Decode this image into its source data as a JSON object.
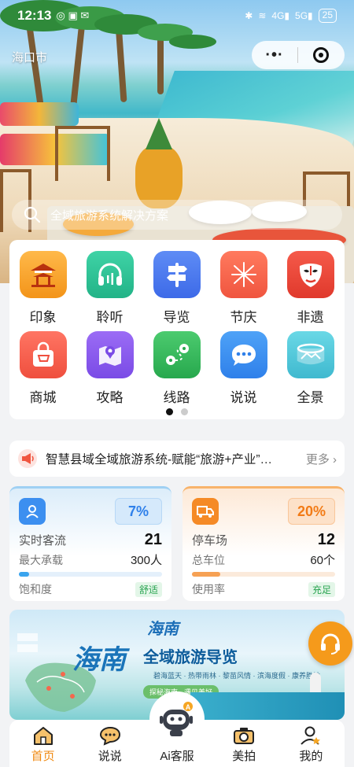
{
  "status": {
    "time": "12:13",
    "battery": "25"
  },
  "header": {
    "city": "海口市",
    "more_icon": "ellipsis-icon",
    "target_icon": "target-icon"
  },
  "search": {
    "placeholder": "全域旅游系统解决方案"
  },
  "menu": {
    "items": [
      {
        "label": "印象",
        "icon": "pavilion-icon",
        "color": "#f6a623"
      },
      {
        "label": "聆听",
        "icon": "headphones-icon",
        "color": "#2fc39a"
      },
      {
        "label": "导览",
        "icon": "signpost-icon",
        "color": "#4a7cf0"
      },
      {
        "label": "节庆",
        "icon": "fireworks-icon",
        "color": "#f5684d"
      },
      {
        "label": "非遗",
        "icon": "opera-mask-icon",
        "color": "#ef4b3c"
      },
      {
        "label": "商城",
        "icon": "shopping-bag-icon",
        "color": "#f4604f"
      },
      {
        "label": "攻略",
        "icon": "map-icon",
        "color": "#8b5cf0"
      },
      {
        "label": "线路",
        "icon": "route-icon",
        "color": "#35b55d"
      },
      {
        "label": "说说",
        "icon": "chat-bubble-icon",
        "color": "#3c8ff0"
      },
      {
        "label": "全景",
        "icon": "panorama-icon",
        "color": "#47c5d8"
      }
    ],
    "page_index": 1,
    "page_count": 2
  },
  "notice": {
    "text": "智慧县域全域旅游系统-赋能“旅游+产业”…",
    "more": "更多"
  },
  "stats": {
    "visitors": {
      "percent": "7%",
      "label": "实时客流",
      "value": "21",
      "cap_label": "最大承载",
      "cap_value": "300人",
      "level_label": "饱和度",
      "level": "舒适",
      "fill": 0.07
    },
    "parking": {
      "percent": "20%",
      "label": "停车场",
      "value": "12",
      "cap_label": "总车位",
      "cap_value": "60个",
      "level_label": "使用率",
      "level": "充足",
      "fill": 0.2
    }
  },
  "banner": {
    "logo": "海南",
    "title_big": "海南",
    "title": "全域旅游导览",
    "subtitle": "碧海蓝天 · 热带雨林 · 黎苗风情 · 滨海度假 · 康养胜地",
    "slogan": "探秘海南 · 遇见美好"
  },
  "tabbar": [
    {
      "label": "首页",
      "icon": "home-icon",
      "active": true
    },
    {
      "label": "说说",
      "icon": "chat-icon"
    },
    {
      "label": "Ai客服",
      "icon": "robot-icon"
    },
    {
      "label": "美拍",
      "icon": "camera-icon"
    },
    {
      "label": "我的",
      "icon": "user-icon"
    }
  ]
}
